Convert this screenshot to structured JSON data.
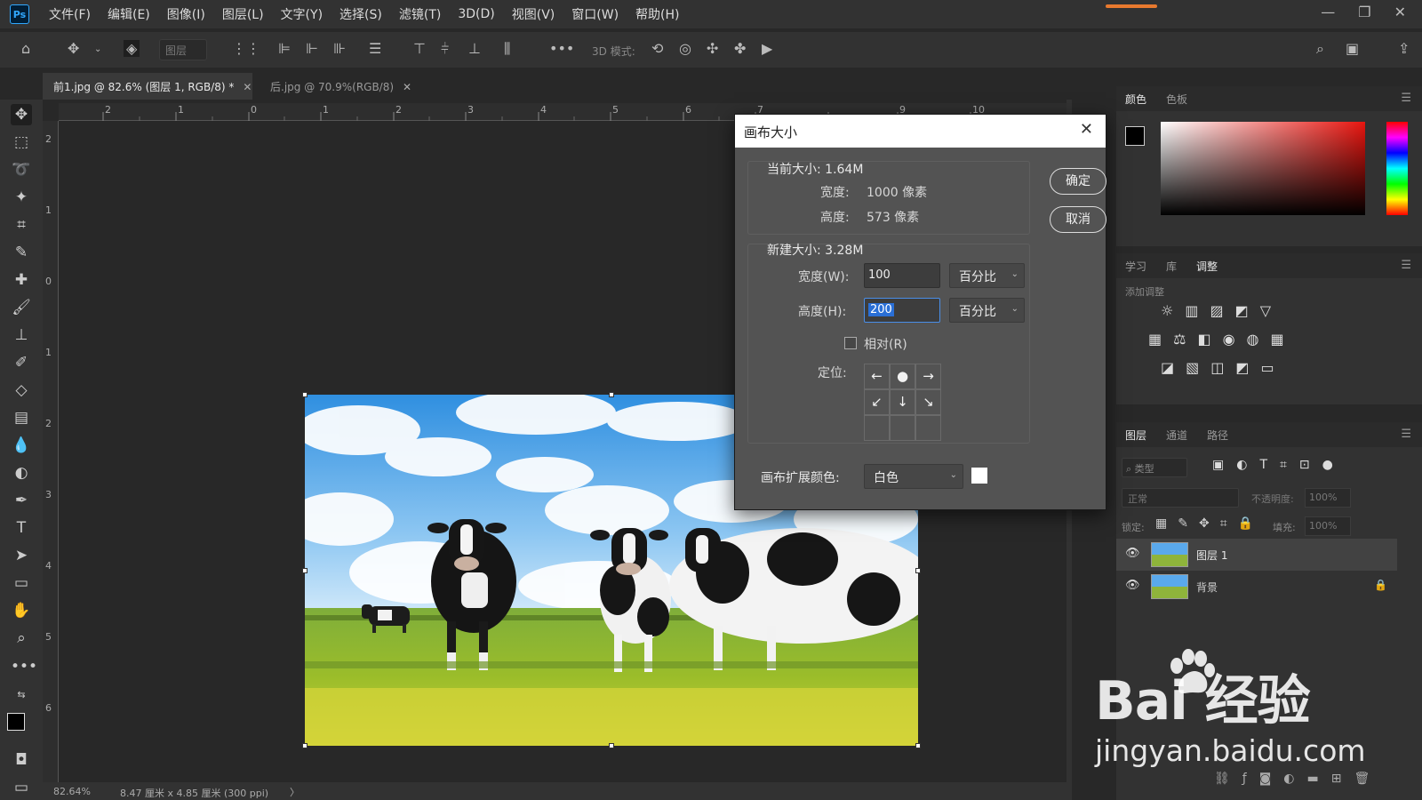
{
  "menu": {
    "items": [
      "文件(F)",
      "编辑(E)",
      "图像(I)",
      "图层(L)",
      "文字(Y)",
      "选择(S)",
      "滤镜(T)",
      "3D(D)",
      "视图(V)",
      "窗口(W)",
      "帮助(H)"
    ],
    "logo": "Ps"
  },
  "options": {
    "layer_dropdown": "图层",
    "mode_3d_label": "3D 模式:"
  },
  "tabs": [
    {
      "label": "前1.jpg @ 82.6% (图层 1, RGB/8) *"
    },
    {
      "label": "后.jpg @ 70.9%(RGB/8)"
    }
  ],
  "ruler": {
    "top": [
      "2",
      "1",
      "0",
      "1",
      "2",
      "3",
      "4",
      "5",
      "6",
      "7",
      "9",
      "10"
    ],
    "left": [
      "2",
      "1",
      "0",
      "1",
      "2",
      "3",
      "4",
      "5",
      "6"
    ]
  },
  "status": {
    "zoom": "82.64%",
    "doc_size": "8.47 厘米 x 4.85 厘米 (300 ppi)"
  },
  "dialog": {
    "title": "画布大小",
    "current_size_label": "当前大小: 1.64M",
    "width_label": "宽度:",
    "width_value": "1000 像素",
    "height_label": "高度:",
    "height_value": "573 像素",
    "new_size_label": "新建大小: 3.28M",
    "new_width_label": "宽度(W):",
    "new_width_value": "100",
    "new_height_label": "高度(H):",
    "new_height_value": "200",
    "unit_option": "百分比",
    "relative_label": "相对(R)",
    "anchor_label": "定位:",
    "ext_color_label": "画布扩展颜色:",
    "ext_color_value": "白色",
    "ok_label": "确定",
    "cancel_label": "取消"
  },
  "color_panel": {
    "tabs": [
      "颜色",
      "色板"
    ]
  },
  "adjust_panel": {
    "tabs": [
      "学习",
      "库",
      "调整"
    ],
    "subtitle": "添加调整"
  },
  "layers_panel": {
    "tabs": [
      "图层",
      "通道",
      "路径"
    ],
    "kind_placeholder": "类型",
    "blend_mode": "正常",
    "opacity_label": "不透明度:",
    "opacity_value": "100%",
    "lock_label": "锁定:",
    "fill_label": "填充:",
    "fill_value": "100%",
    "layers": [
      {
        "name": "图层 1"
      },
      {
        "name": "背景"
      }
    ]
  },
  "watermark": {
    "brand": "Bai  经验",
    "url": "jingyan.baidu.com"
  },
  "colors": {
    "accent": "#31a8ff",
    "dialog_bg": "#535353",
    "panel_bg": "#323232",
    "canvas_bg": "#282828"
  }
}
